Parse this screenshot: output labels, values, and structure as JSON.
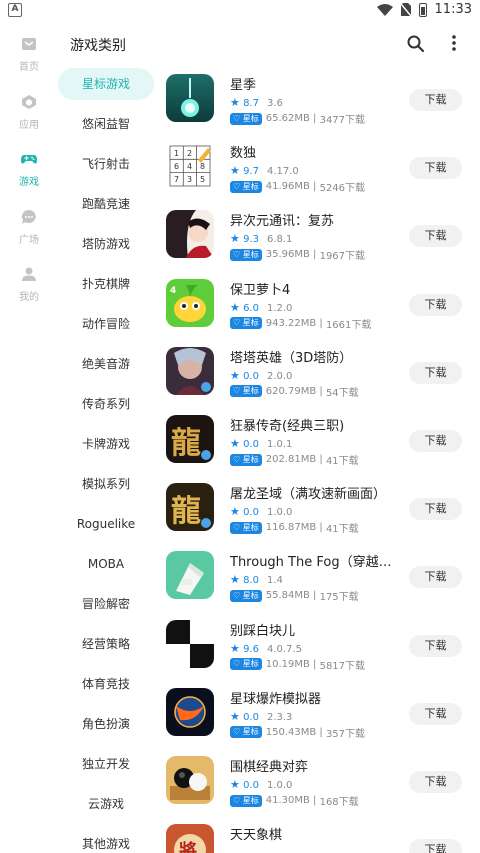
{
  "status_bar": {
    "time": "11:33",
    "left_badge": "A"
  },
  "rail": [
    {
      "label": "首页",
      "icon": "home-icon",
      "active": false
    },
    {
      "label": "应用",
      "icon": "apps-icon",
      "active": false
    },
    {
      "label": "游戏",
      "icon": "gamepad-icon",
      "active": true
    },
    {
      "label": "广场",
      "icon": "chat-icon",
      "active": false
    },
    {
      "label": "我的",
      "icon": "person-icon",
      "active": false
    }
  ],
  "appbar": {
    "title": "游戏类别"
  },
  "categories": [
    "星标游戏",
    "悠闲益智",
    "飞行射击",
    "跑酷竞速",
    "塔防游戏",
    "扑克棋牌",
    "动作冒险",
    "绝美音游",
    "传奇系列",
    "卡牌游戏",
    "模拟系列",
    "Roguelike",
    "MOBA",
    "冒险解密",
    "经营策略",
    "体育竞技",
    "角色扮演",
    "独立开发",
    "云游戏",
    "其他游戏"
  ],
  "active_category": 0,
  "download_label": "下载",
  "badge_label": "星标",
  "games": [
    {
      "name": "星季",
      "score": "8.7",
      "version": "3.6",
      "size": "65.62MB",
      "downloads": "3477下载"
    },
    {
      "name": "数独",
      "score": "9.7",
      "version": "4.17.0",
      "size": "41.96MB",
      "downloads": "5246下载"
    },
    {
      "name": "异次元通讯：复苏",
      "score": "9.3",
      "version": "6.8.1",
      "size": "35.96MB",
      "downloads": "1967下载"
    },
    {
      "name": "保卫萝卜4",
      "score": "6.0",
      "version": "1.2.0",
      "size": "943.22MB",
      "downloads": "1661下载"
    },
    {
      "name": "塔塔英雄（3D塔防）",
      "score": "0.0",
      "version": "2.0.0",
      "size": "620.79MB",
      "downloads": "54下载"
    },
    {
      "name": "狂暴传奇(经典三职)",
      "score": "0.0",
      "version": "1.0.1",
      "size": "202.81MB",
      "downloads": "41下载"
    },
    {
      "name": "屠龙圣域（满攻速新画面）",
      "score": "0.0",
      "version": "1.0.0",
      "size": "116.87MB",
      "downloads": "41下载"
    },
    {
      "name": "Through The Fog（穿越迷雾...",
      "score": "8.0",
      "version": "1.4",
      "size": "55.84MB",
      "downloads": "175下载"
    },
    {
      "name": "别踩白块儿",
      "score": "9.6",
      "version": "4.0.7.5",
      "size": "10.19MB",
      "downloads": "5817下载"
    },
    {
      "name": "星球爆炸模拟器",
      "score": "0.0",
      "version": "2.3.3",
      "size": "150.43MB",
      "downloads": "357下载"
    },
    {
      "name": "围棋经典对弈",
      "score": "0.0",
      "version": "1.0.0",
      "size": "41.30MB",
      "downloads": "168下载"
    },
    {
      "name": "天天象棋",
      "score": "",
      "version": "",
      "size": "",
      "downloads": ""
    }
  ],
  "colors": {
    "accent": "#1fb5b0",
    "badge_blue": "#1c86e3"
  }
}
